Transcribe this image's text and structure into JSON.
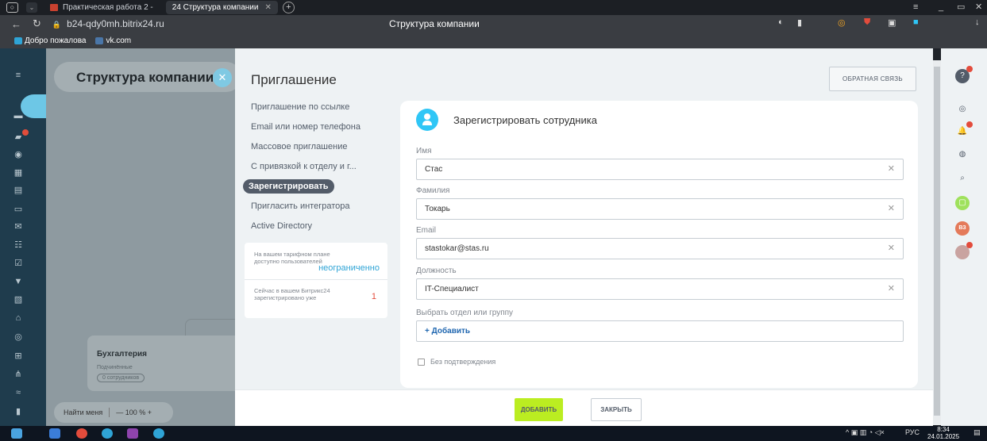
{
  "browser": {
    "tabs": [
      {
        "label": "Практическая работа 2 -"
      },
      {
        "label": "24  Структура компании",
        "active": true
      }
    ],
    "url": "b24-qdy0mh.bitrix24.ru",
    "page_title": "Структура компании",
    "bookmarks": [
      {
        "label": "Добро пожалова"
      },
      {
        "label": "vk.com"
      }
    ]
  },
  "background_app": {
    "title": "Структура компании",
    "dept_card": {
      "title": "Бухгалтерия",
      "subtitle": "Подчинённые",
      "count": "0 сотрудников"
    },
    "find_me": "Найти меня",
    "zoom": "— 100 % +"
  },
  "panel": {
    "title": "Приглашение",
    "feedback_button": "ОБРАТНАЯ СВЯЗЬ",
    "menu": [
      {
        "label": "Приглашение по ссылке"
      },
      {
        "label": "Email или номер телефона"
      },
      {
        "label": "Массовое приглашение"
      },
      {
        "label": "С привязкой к отделу и г..."
      },
      {
        "label": "Зарегистрировать",
        "active": true
      },
      {
        "label": "Пригласить интегратора"
      },
      {
        "label": "Active Directory"
      }
    ],
    "tariff": {
      "available_label": "На вашем тарифном плане доступно пользователей",
      "available_value": "неограниченно",
      "registered_label": "Сейчас в вашем Битрикс24 зарегистрировано уже",
      "registered_value": "1"
    },
    "form": {
      "title": "Зарегистрировать сотрудника",
      "fields": [
        {
          "label": "Имя",
          "value": "Стас"
        },
        {
          "label": "Фамилия",
          "value": "Токарь"
        },
        {
          "label": "Email",
          "value": "stastokar@stas.ru"
        },
        {
          "label": "Должность",
          "value": "IT-Специалист"
        }
      ],
      "department_label": "Выбрать отдел или группу",
      "department_add": "+ Добавить",
      "no_confirm_label": "Без подтверждения"
    },
    "add_button": "ДОБАВИТЬ",
    "close_button": "ЗАКРЫТЬ"
  },
  "right_sidebar": {
    "user_initials": "ВЗ"
  },
  "taskbar": {
    "lang": "РУС",
    "time": "8:34",
    "date": "24.01.2025"
  }
}
